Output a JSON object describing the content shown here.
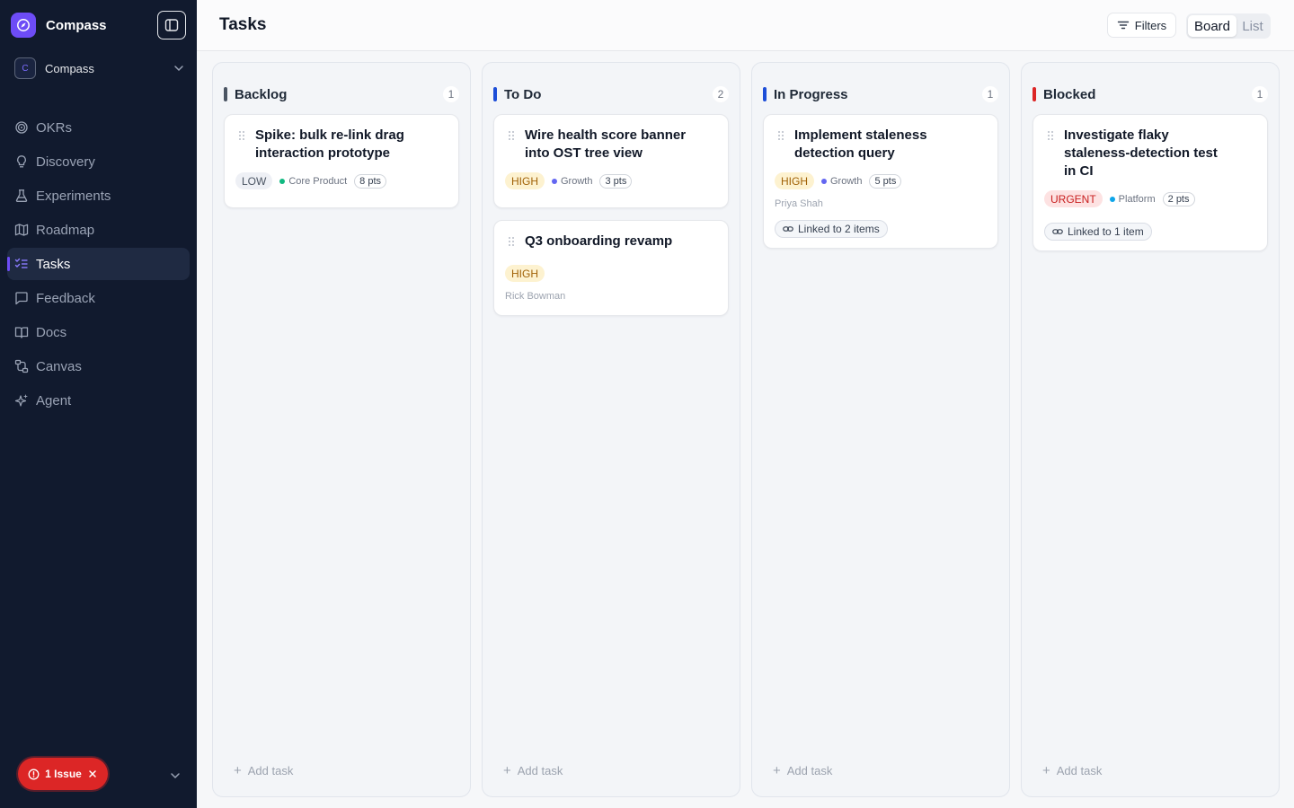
{
  "app": {
    "name": "Compass",
    "workspace": {
      "initial": "C",
      "name": "Compass"
    }
  },
  "nav": [
    {
      "label": "OKRs",
      "icon": "target-icon",
      "active": false
    },
    {
      "label": "Discovery",
      "icon": "lightbulb-icon",
      "active": false
    },
    {
      "label": "Experiments",
      "icon": "flask-icon",
      "active": false
    },
    {
      "label": "Roadmap",
      "icon": "map-icon",
      "active": false
    },
    {
      "label": "Tasks",
      "icon": "checklist-icon",
      "active": true
    },
    {
      "label": "Feedback",
      "icon": "message-icon",
      "active": false
    },
    {
      "label": "Docs",
      "icon": "book-icon",
      "active": false
    },
    {
      "label": "Canvas",
      "icon": "workflow-icon",
      "active": false
    },
    {
      "label": "Agent",
      "icon": "sparkles-icon",
      "active": false
    }
  ],
  "issues": {
    "label": "1 Issue"
  },
  "header": {
    "title": "Tasks",
    "filters_label": "Filters",
    "views": {
      "board": "Board",
      "list": "List",
      "active": "board"
    }
  },
  "columns": [
    {
      "title": "Backlog",
      "count": "1",
      "color": "#4b5563",
      "add_label": "Add task",
      "cards": [
        {
          "title": "Spike: bulk re-link drag interaction prototype",
          "priority": "LOW",
          "team": "Core Product",
          "team_color": "#10b981",
          "points": "8 pts"
        }
      ]
    },
    {
      "title": "To Do",
      "count": "2",
      "color": "#1d4ed8",
      "add_label": "Add task",
      "cards": [
        {
          "title": "Wire health score banner into OST tree view",
          "priority": "HIGH",
          "team": "Growth",
          "team_color": "#6366f1",
          "points": "3 pts"
        },
        {
          "title": "Q3 onboarding revamp",
          "priority": "HIGH",
          "assignee": "Rick Bowman"
        }
      ]
    },
    {
      "title": "In Progress",
      "count": "1",
      "color": "#1d4ed8",
      "add_label": "Add task",
      "cards": [
        {
          "title": "Implement staleness detection query",
          "priority": "HIGH",
          "team": "Growth",
          "team_color": "#6366f1",
          "points": "5 pts",
          "assignee": "Priya Shah",
          "linked": "Linked to 2 items"
        }
      ]
    },
    {
      "title": "Blocked",
      "count": "1",
      "color": "#dc2626",
      "add_label": "Add task",
      "cards": [
        {
          "title": "Investigate flaky staleness-detection test in CI",
          "priority": "URGENT",
          "team": "Platform",
          "team_color": "#0ea5e9",
          "points": "2 pts",
          "linked": "Linked to 1 item"
        }
      ]
    }
  ]
}
